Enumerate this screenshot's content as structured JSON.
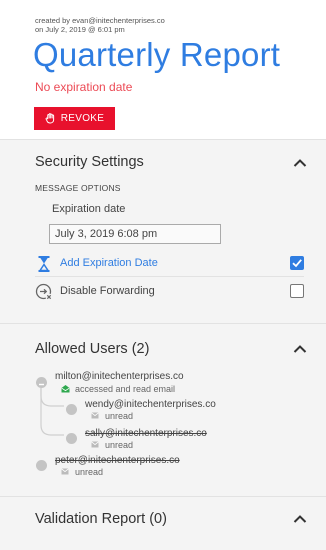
{
  "header": {
    "created_by": "created by evan@initechenterprises.co",
    "created_on": "on July 2, 2019 @ 6:01 pm",
    "title": "Quarterly Report",
    "expiration_status": "No expiration date",
    "revoke_label": "REVOKE"
  },
  "security": {
    "title": "Security Settings",
    "message_options_label": "MESSAGE OPTIONS",
    "expiration_label": "Expiration date",
    "expiration_value": "July 3, 2019 6:08 pm",
    "options": [
      {
        "label": "Add Expiration Date",
        "icon": "hourglass-icon",
        "checked": true
      },
      {
        "label": "Disable Forwarding",
        "icon": "no-forward-icon",
        "checked": false
      }
    ]
  },
  "allowed_users": {
    "title": "Allowed Users (2)",
    "users": [
      {
        "email": "milton@initechenterprises.co",
        "status": "accessed and read email",
        "revoked": false,
        "status_icon": "opened-envelope-icon"
      },
      {
        "email": "wendy@initechenterprises.co",
        "status": "unread",
        "revoked": false,
        "status_icon": "envelope-icon"
      },
      {
        "email": "sally@initechenterprises.co",
        "status": "unread",
        "revoked": true,
        "status_icon": "envelope-icon"
      },
      {
        "email": "peter@initechenterprises.co",
        "status": "unread",
        "revoked": true,
        "status_icon": "envelope-icon"
      }
    ]
  },
  "validation": {
    "title": "Validation Report (0)"
  },
  "colors": {
    "accent": "#2f7de1",
    "danger": "#e8112d",
    "expiry_text": "#ec4a55",
    "read_icon": "#2fa84f"
  }
}
